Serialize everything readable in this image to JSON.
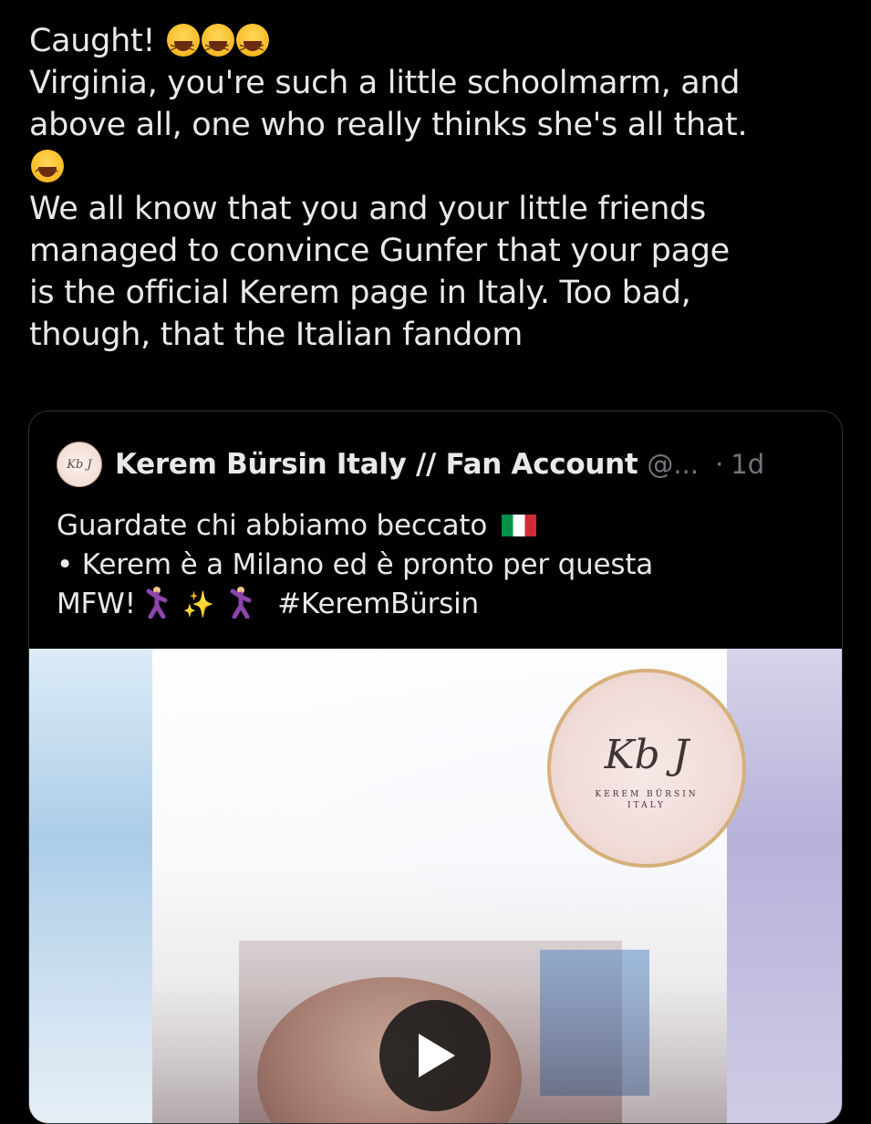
{
  "tweet": {
    "lines": [
      "Caught!",
      "Virginia, you're such a little schoolmarm, and",
      "above all, one who really thinks she's all that.",
      "We all know that you and your little friends",
      "managed to convince Gunfer that your page",
      "is the official Kerem page in Italy. Too bad,",
      "though, that the Italian fandom"
    ],
    "emojis": [
      "laughing-face-icon",
      "laughing-face-icon",
      "laughing-face-icon",
      "tears-of-joy-icon"
    ]
  },
  "quote": {
    "author_name": "Kerem Bürsin Italy // Fan Account",
    "handle": "@...",
    "separator": "·",
    "time": "1d",
    "avatar_text": "Kb J",
    "lines": [
      "Guardate chi abbiamo beccato",
      "• Kerem è a Milano ed è pronto per questa",
      "MFW!",
      "#KeremBürsin"
    ],
    "emojis": [
      "italy-flag-icon",
      "dancing-man-icon",
      "sparkles-icon",
      "dancing-man-icon"
    ]
  },
  "media": {
    "logo_script": "Kb J",
    "logo_line1": "KEREM BÜRSIN",
    "logo_line2": "ITALY",
    "play_icon": "play-icon"
  },
  "colors": {
    "background": "#000000",
    "text": "#e7e9ea",
    "muted": "#71767b",
    "border": "#2f3336"
  }
}
